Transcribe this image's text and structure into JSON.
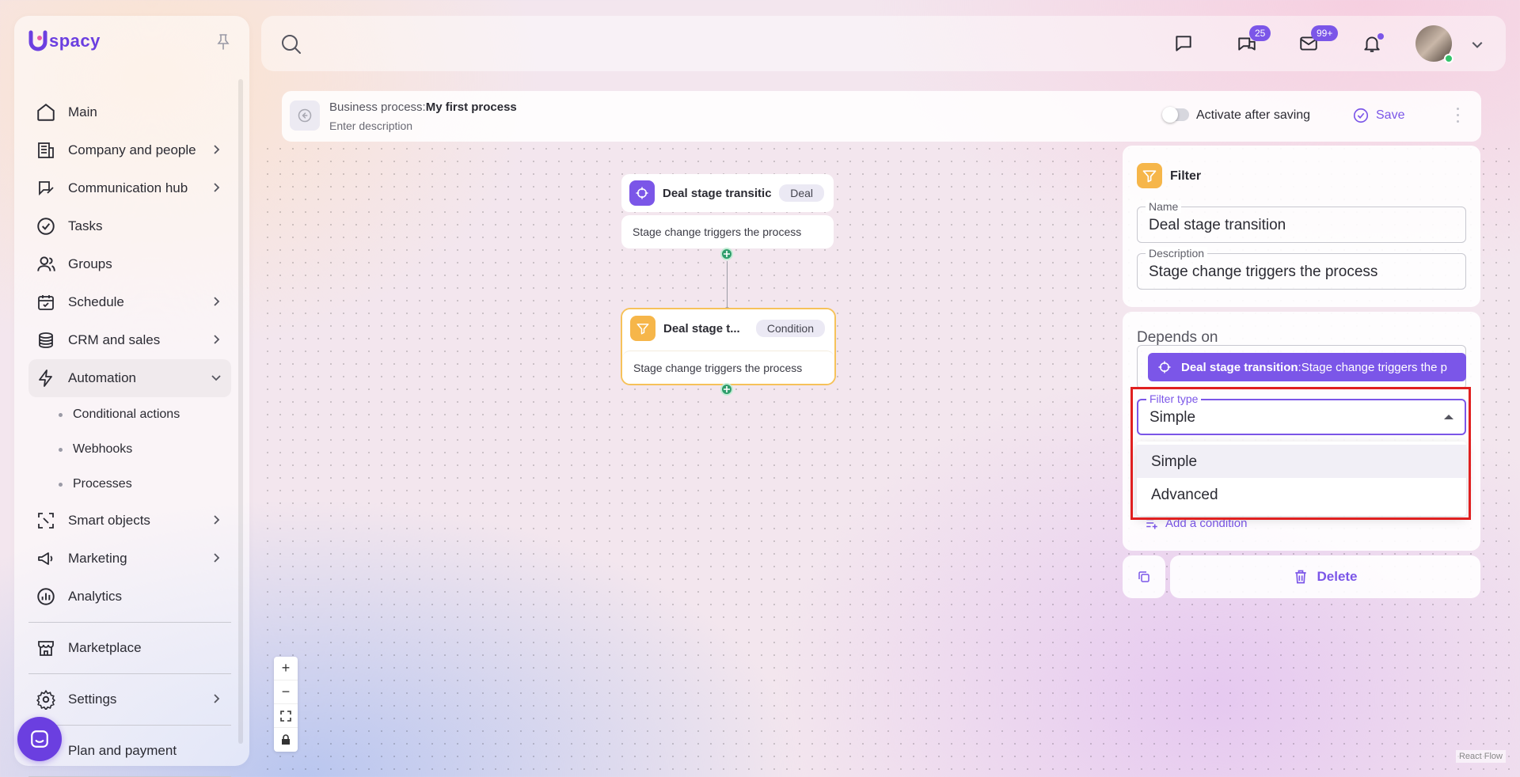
{
  "app": {
    "logo_text": "spacy",
    "brand_color": "#6b3fe0"
  },
  "sidebar": {
    "items": [
      {
        "label": "Main",
        "icon": "home-icon"
      },
      {
        "label": "Company and people",
        "icon": "building-icon"
      },
      {
        "label": "Communication hub",
        "icon": "chat-edit-icon"
      },
      {
        "label": "Tasks",
        "icon": "check-circle-icon"
      },
      {
        "label": "Groups",
        "icon": "users-icon"
      },
      {
        "label": "Schedule",
        "icon": "calendar-icon"
      },
      {
        "label": "CRM and sales",
        "icon": "coins-icon"
      },
      {
        "label": "Automation",
        "icon": "lightning-icon"
      }
    ],
    "automation_sub": [
      "Conditional actions",
      "Webhooks",
      "Processes"
    ],
    "items2": [
      {
        "label": "Smart objects",
        "icon": "scan-icon"
      },
      {
        "label": "Marketing",
        "icon": "megaphone-icon"
      },
      {
        "label": "Analytics",
        "icon": "chart-icon"
      }
    ],
    "marketplace": "Marketplace",
    "settings": "Settings",
    "plan": "Plan and payment"
  },
  "topbar": {
    "chats_badge": "25",
    "mail_badge": "99+"
  },
  "process": {
    "prefix": "Business process:",
    "name": "My first process",
    "description_placeholder": "Enter description",
    "activate_label": "Activate after saving",
    "save_label": "Save"
  },
  "nodes": [
    {
      "title": "Deal stage transitic",
      "tag": "Deal",
      "body": "Stage change triggers the process"
    },
    {
      "title": "Deal stage t...",
      "tag": "Condition",
      "body": "Stage change triggers the process"
    }
  ],
  "panel": {
    "title": "Filter",
    "name_label": "Name",
    "name_value": "Deal stage transition",
    "desc_label": "Description",
    "desc_value": "Stage change triggers the process",
    "depends_label": "Depends on",
    "depends_chip_bold": "Deal stage transition",
    "depends_chip_rest": " :Stage change triggers the p",
    "filter_type_label": "Filter type",
    "filter_type_value": "Simple",
    "options": [
      "Simple",
      "Advanced"
    ],
    "add_condition": "Add a condition",
    "delete_label": "Delete"
  },
  "canvas": {
    "attribution": "React Flow"
  },
  "colors": {
    "accent": "#7b56e8",
    "highlight": "#e02020",
    "trigger_node": "#7b56e8",
    "filter_node": "#f6b64a",
    "port": "#2e9d6b"
  }
}
